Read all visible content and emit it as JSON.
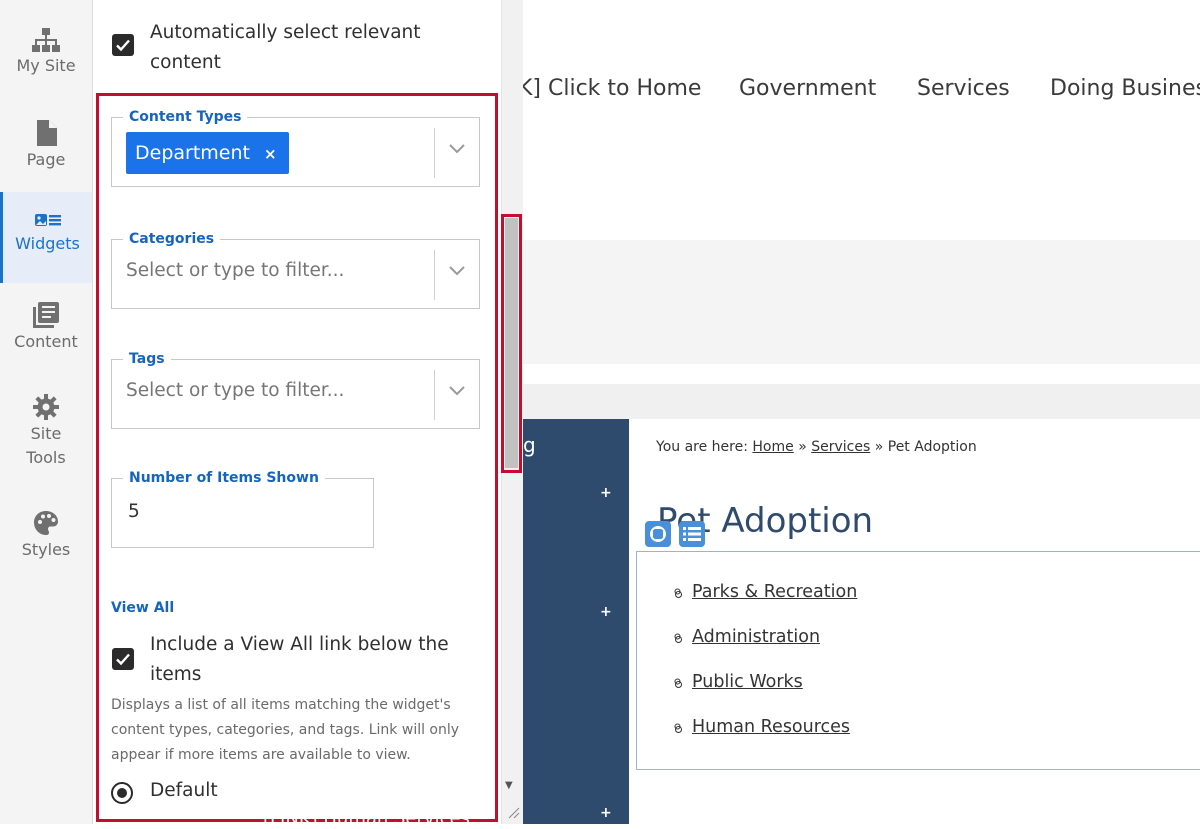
{
  "nav": {
    "items": [
      {
        "label": "My Site",
        "icon": "sitemap-icon"
      },
      {
        "label": "Page",
        "icon": "page-icon"
      },
      {
        "label": "Widgets",
        "icon": "widgets-icon"
      },
      {
        "label": "Content",
        "icon": "content-icon"
      },
      {
        "label": "Site",
        "label2": "Tools",
        "icon": "gear-icon"
      },
      {
        "label": "Styles",
        "icon": "palette-icon"
      }
    ],
    "active": "Widgets"
  },
  "panel": {
    "auto_select": {
      "line1": "Automatically select relevant",
      "line2": "content",
      "checked": true
    },
    "content_types": {
      "legend": "Content Types",
      "chip": "Department",
      "chip_remove": "×"
    },
    "categories": {
      "legend": "Categories",
      "placeholder": "Select or type to filter..."
    },
    "tags": {
      "legend": "Tags",
      "placeholder": "Select or type to filter..."
    },
    "items_shown": {
      "legend": "Number of Items Shown",
      "value": "5"
    },
    "view_all": {
      "heading": "View All",
      "line1": "Include a View All link below the",
      "line2": "items",
      "checked": true,
      "help": "Displays a list of all items matching the widget's content types, categories, and tags. Link will only appear if more items are available to view."
    },
    "radio_default": "Default"
  },
  "site": {
    "topnav": [
      "K] Click to Home",
      "Government",
      "Services",
      "Doing Business"
    ],
    "side_fragment": "g",
    "breadcrumb": {
      "prefix": "You are here:",
      "home": "Home",
      "sep": "»",
      "services": " Services",
      "current": "Pet Adoption"
    },
    "page_title": "Pet Adoption",
    "list": [
      "Parks & Recreation",
      "Administration",
      "Public Works",
      "Human Resources"
    ],
    "bottom_fragment": "[LINK] Human Services"
  },
  "colors": {
    "accent": "#1a73e8",
    "highlight": "#c0102e",
    "site_navy": "#2e4a6d"
  }
}
